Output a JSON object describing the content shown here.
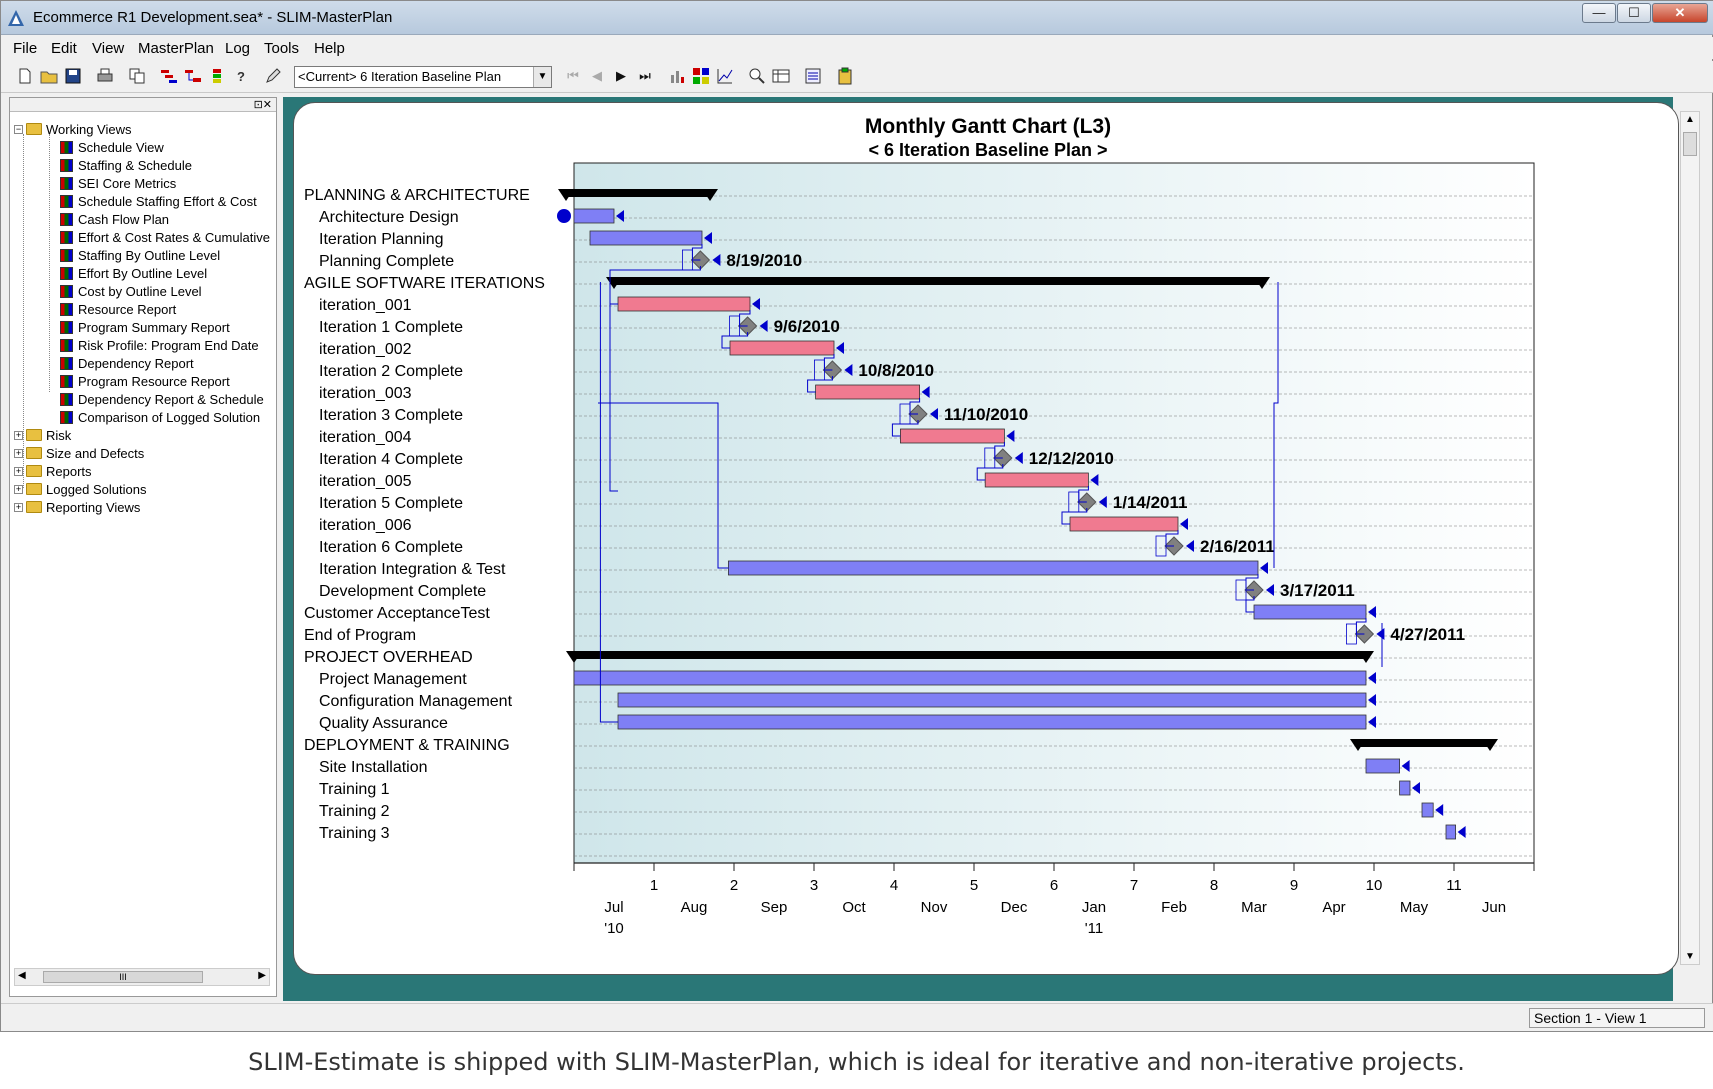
{
  "window": {
    "title": "Ecommerce R1 Development.sea* - SLIM-MasterPlan",
    "minimize": "—",
    "maximize": "☐",
    "close": "✕"
  },
  "menu": [
    "File",
    "Edit",
    "View",
    "MasterPlan",
    "Log",
    "Tools",
    "Help"
  ],
  "toolbar": {
    "view_select": "<Current> 6 Iteration Baseline Plan"
  },
  "tree": {
    "root": "Working Views",
    "views": [
      "Schedule View",
      "Staffing & Schedule",
      "SEI Core Metrics",
      "Schedule Staffing Effort & Cost",
      "Cash Flow Plan",
      "Effort & Cost Rates & Cumulative",
      "Staffing By Outline Level",
      "Effort By Outline Level",
      "Cost by Outline Level",
      "Resource Report",
      "Program Summary Report",
      "Risk Profile: Program End Date",
      "Dependency Report",
      "Program Resource Report",
      "Dependency Report & Schedule",
      "Comparison of Logged Solution"
    ],
    "folders": [
      "Risk",
      "Size and Defects",
      "Reports",
      "Logged Solutions",
      "Reporting Views"
    ],
    "scroll_thumb": "III"
  },
  "status": {
    "section": "Section 1 - View 1"
  },
  "caption": "SLIM-Estimate is shipped with SLIM-MasterPlan, which is ideal for iterative and non-iterative projects.",
  "colors": {
    "task_bar": "#7f7ff5",
    "iteration_bar": "#f07a90",
    "summary_bar": "#000000",
    "milestone": "#808080",
    "link": "#0000cc"
  },
  "chart_data": {
    "type": "gantt",
    "title": "Monthly Gantt Chart  (L3)",
    "subtitle": "< 6 Iteration Baseline Plan >",
    "x_months": [
      "Jul",
      "Aug",
      "Sep",
      "Oct",
      "Nov",
      "Dec",
      "Jan",
      "Feb",
      "Mar",
      "Apr",
      "May",
      "Jun"
    ],
    "x_years": [
      "'10",
      "'11"
    ],
    "x_ticks": [
      "1",
      "2",
      "3",
      "4",
      "5",
      "6",
      "7",
      "8",
      "9",
      "10",
      "11"
    ],
    "x_range": [
      0,
      12
    ],
    "rows": [
      {
        "name": "PLANNING & ARCHITECTURE",
        "level": 0,
        "kind": "summary",
        "start": -0.1,
        "end": 1.7
      },
      {
        "name": "Architecture Design",
        "level": 1,
        "kind": "task",
        "start": 0.0,
        "end": 0.5,
        "start_marker": true
      },
      {
        "name": "Iteration Planning",
        "level": 1,
        "kind": "task",
        "start": 0.2,
        "end": 1.6
      },
      {
        "name": "Planning Complete",
        "level": 1,
        "kind": "milestone",
        "at": 1.58,
        "label": "8/19/2010"
      },
      {
        "name": "AGILE SOFTWARE ITERATIONS",
        "level": 0,
        "kind": "summary",
        "start": 0.5,
        "end": 8.6
      },
      {
        "name": "iteration_001",
        "level": 1,
        "kind": "iteration",
        "start": 0.55,
        "end": 2.2
      },
      {
        "name": "Iteration 1 Complete",
        "level": 1,
        "kind": "milestone",
        "at": 2.17,
        "label": "9/6/2010"
      },
      {
        "name": "iteration_002",
        "level": 1,
        "kind": "iteration",
        "start": 1.95,
        "end": 3.25
      },
      {
        "name": "Iteration 2 Complete",
        "level": 1,
        "kind": "milestone",
        "at": 3.23,
        "label": "10/8/2010"
      },
      {
        "name": "iteration_003",
        "level": 1,
        "kind": "iteration",
        "start": 3.02,
        "end": 4.32
      },
      {
        "name": "Iteration 3 Complete",
        "level": 1,
        "kind": "milestone",
        "at": 4.3,
        "label": "11/10/2010"
      },
      {
        "name": "iteration_004",
        "level": 1,
        "kind": "iteration",
        "start": 4.08,
        "end": 5.38
      },
      {
        "name": "Iteration 4 Complete",
        "level": 1,
        "kind": "milestone",
        "at": 5.36,
        "label": "12/12/2010"
      },
      {
        "name": "iteration_005",
        "level": 1,
        "kind": "iteration",
        "start": 5.14,
        "end": 6.43
      },
      {
        "name": "Iteration 5 Complete",
        "level": 1,
        "kind": "milestone",
        "at": 6.41,
        "label": "1/14/2011"
      },
      {
        "name": "iteration_006",
        "level": 1,
        "kind": "iteration",
        "start": 6.2,
        "end": 7.55
      },
      {
        "name": "Iteration 6 Complete",
        "level": 1,
        "kind": "milestone",
        "at": 7.5,
        "label": "2/16/2011"
      },
      {
        "name": "Iteration Integration & Test",
        "level": 1,
        "kind": "task",
        "start": 1.93,
        "end": 8.55
      },
      {
        "name": "Development Complete",
        "level": 1,
        "kind": "milestone",
        "at": 8.5,
        "label": "3/17/2011"
      },
      {
        "name": "Customer AcceptanceTest",
        "level": 0,
        "kind": "task",
        "start": 8.5,
        "end": 9.9
      },
      {
        "name": "End of Program",
        "level": 0,
        "kind": "milestone",
        "at": 9.88,
        "label": "4/27/2011"
      },
      {
        "name": "PROJECT OVERHEAD",
        "level": 0,
        "kind": "summary",
        "start": 0.0,
        "end": 9.9
      },
      {
        "name": "Project Management",
        "level": 1,
        "kind": "task",
        "start": 0.0,
        "end": 9.9
      },
      {
        "name": "Configuration Management",
        "level": 1,
        "kind": "task",
        "start": 0.55,
        "end": 9.9
      },
      {
        "name": "Quality Assurance",
        "level": 1,
        "kind": "task",
        "start": 0.55,
        "end": 9.9
      },
      {
        "name": "DEPLOYMENT & TRAINING",
        "level": 0,
        "kind": "summary",
        "start": 9.8,
        "end": 11.45
      },
      {
        "name": "Site Installation",
        "level": 1,
        "kind": "task",
        "start": 9.9,
        "end": 10.32
      },
      {
        "name": "Training 1",
        "level": 1,
        "kind": "task",
        "start": 10.32,
        "end": 10.45
      },
      {
        "name": "Training 2",
        "level": 1,
        "kind": "task",
        "start": 10.6,
        "end": 10.74
      },
      {
        "name": "Training 3",
        "level": 1,
        "kind": "task",
        "start": 10.9,
        "end": 11.02
      }
    ]
  }
}
